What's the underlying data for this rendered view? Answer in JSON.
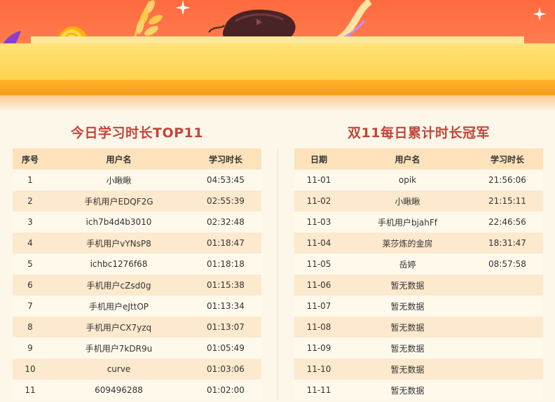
{
  "colors": {
    "accent_title": "#c3453a",
    "banner": "#ff6a3f",
    "stage": "#ffd24c",
    "header_row": "#fde2bb",
    "row_alt": "#fde9cd"
  },
  "banner": {
    "icons": [
      "sparkle-icon",
      "wheat-icon",
      "gold-coin-icon",
      "gaming-mouse-icon",
      "coin-stack-icon",
      "ribbon-icon"
    ]
  },
  "left_board": {
    "title": "今日学习时长TOP11",
    "headers": {
      "rank": "序号",
      "user": "用户名",
      "time": "学习时长"
    },
    "rows": [
      {
        "rank": "1",
        "user": "小瞅瞅",
        "time": "04:53:45"
      },
      {
        "rank": "2",
        "user": "手机用户EDQF2G",
        "time": "02:55:39"
      },
      {
        "rank": "3",
        "user": "ich7b4d4b3010",
        "time": "02:32:48"
      },
      {
        "rank": "4",
        "user": "手机用户vYNsP8",
        "time": "01:18:47"
      },
      {
        "rank": "5",
        "user": "ichbc1276f68",
        "time": "01:18:18"
      },
      {
        "rank": "6",
        "user": "手机用户cZsd0g",
        "time": "01:15:38"
      },
      {
        "rank": "7",
        "user": "手机用户eJttOP",
        "time": "01:13:34"
      },
      {
        "rank": "8",
        "user": "手机用户CX7yzq",
        "time": "01:13:07"
      },
      {
        "rank": "9",
        "user": "手机用户7kDR9u",
        "time": "01:05:49"
      },
      {
        "rank": "10",
        "user": "curve",
        "time": "01:03:06"
      },
      {
        "rank": "11",
        "user": "609496288",
        "time": "01:02:00"
      }
    ]
  },
  "right_board": {
    "title": "双11每日累计时长冠军",
    "headers": {
      "date": "日期",
      "user": "用户名",
      "time": "学习时长"
    },
    "rows": [
      {
        "date": "11-01",
        "user": "opik",
        "time": "21:56:06"
      },
      {
        "date": "11-02",
        "user": "小瞅瞅",
        "time": "21:15:11"
      },
      {
        "date": "11-03",
        "user": "手机用户bjahFf",
        "time": "22:46:56"
      },
      {
        "date": "11-04",
        "user": "莱莎炼的金房",
        "time": "18:31:47"
      },
      {
        "date": "11-05",
        "user": "岳婷",
        "time": "08:57:58"
      },
      {
        "date": "11-06",
        "user": "暂无数据",
        "time": ""
      },
      {
        "date": "11-07",
        "user": "暂无数据",
        "time": ""
      },
      {
        "date": "11-08",
        "user": "暂无数据",
        "time": ""
      },
      {
        "date": "11-09",
        "user": "暂无数据",
        "time": ""
      },
      {
        "date": "11-10",
        "user": "暂无数据",
        "time": ""
      },
      {
        "date": "11-11",
        "user": "暂无数据",
        "time": ""
      }
    ]
  }
}
